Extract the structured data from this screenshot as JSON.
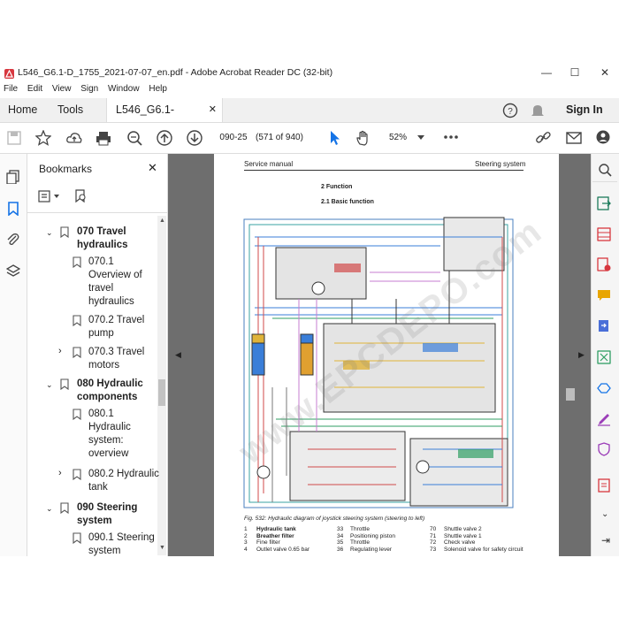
{
  "window": {
    "title": "L546_G6.1-D_1755_2021-07-07_en.pdf - Adobe Acrobat Reader DC (32-bit)",
    "minimize": "—",
    "maximize": "☐",
    "close": "✕"
  },
  "menu": [
    "File",
    "Edit",
    "View",
    "Sign",
    "Window",
    "Help"
  ],
  "tabs": {
    "home": "Home",
    "tools": "Tools",
    "doc": "L546_G6.1-D_1755...",
    "doc_close": "✕",
    "sign_in": "Sign In"
  },
  "toolbar": {
    "page_value": "090-25",
    "page_count": "(571 of 940)",
    "zoom": "52%"
  },
  "bookmarks": {
    "title": "Bookmarks",
    "close": "✕",
    "items": [
      {
        "label": "070 Travel hydraulics",
        "bold": true
      },
      {
        "label": "070.1 Overview of travel hydraulics",
        "bold": false
      },
      {
        "label": "070.2 Travel pump",
        "bold": false
      },
      {
        "label": "070.3 Travel motors",
        "bold": false
      },
      {
        "label": "080 Hydraulic components",
        "bold": true
      },
      {
        "label": "080.1 Hydraulic system: overview",
        "bold": false
      },
      {
        "label": "080.2 Hydraulic tank",
        "bold": false
      },
      {
        "label": "090 Steering system",
        "bold": true
      },
      {
        "label": "090.1 Steering system",
        "bold": false
      }
    ]
  },
  "page": {
    "header_left": "Service manual",
    "header_right": "Steering system",
    "section": "2 Function",
    "subsection": "2.1 Basic function",
    "caption": "Fig. 532: Hydraulic diagram of joystick steering system (steering to left)",
    "legend": [
      [
        "1",
        "Hydraulic tank",
        "33",
        "Throttle",
        "70",
        "Shuttle valve 2"
      ],
      [
        "2",
        "Breather filter",
        "34",
        "Positioning piston",
        "71",
        "Shuttle valve 1"
      ],
      [
        "3",
        "Fine filter",
        "35",
        "Throttle",
        "72",
        "Check valve"
      ],
      [
        "4",
        "Outlet valve 0.65 bar",
        "36",
        "Regulating lever",
        "73",
        "Solenoid valve for safety circuit"
      ]
    ],
    "watermark": "www.EPCDEPO.com"
  },
  "colors": {
    "accent": "#1473e6",
    "doc_background": "#6e6e6e"
  }
}
